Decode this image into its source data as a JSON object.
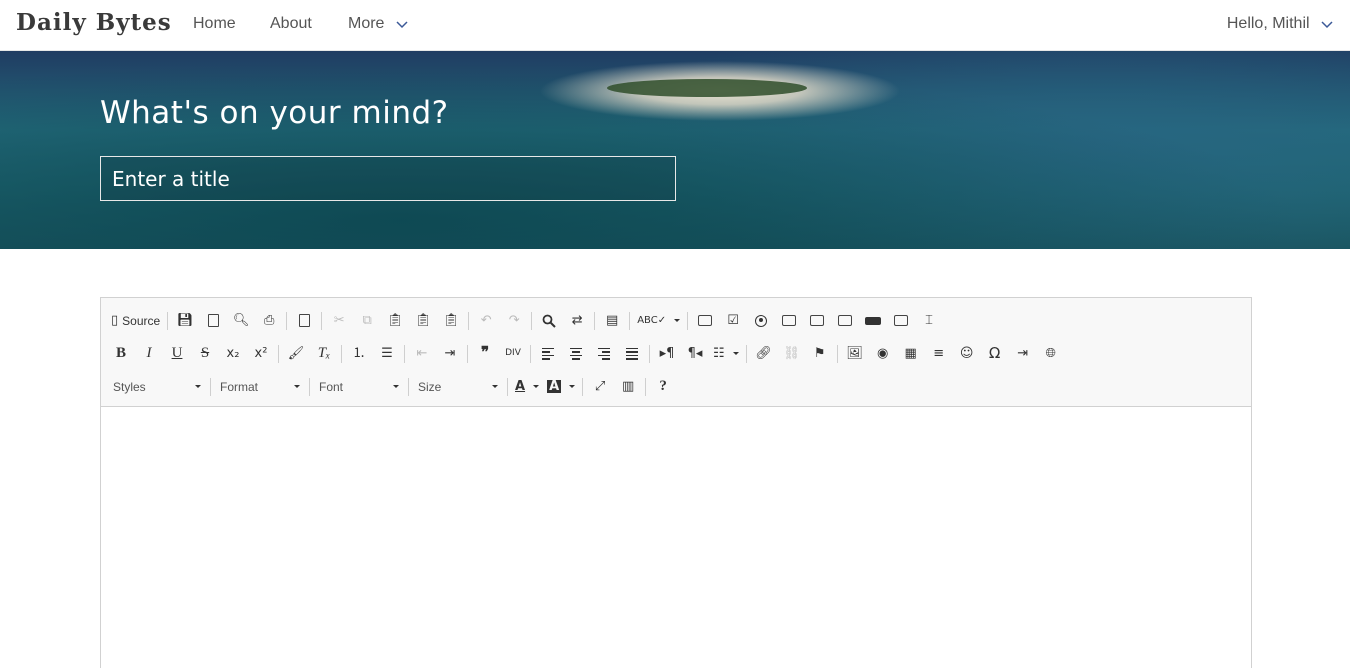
{
  "navbar": {
    "brand": "Daily Bytes",
    "links": [
      "Home",
      "About",
      "More"
    ],
    "user_label": "Hello, Mithil"
  },
  "hero": {
    "heading": "What's on your mind?",
    "title_placeholder": "Enter a title"
  },
  "editor": {
    "source_label": "Source",
    "combos": {
      "styles": "Styles",
      "format": "Format",
      "font": "Font",
      "size": "Size"
    },
    "help_label": "?",
    "content": ""
  },
  "colors": {
    "nav_bg": "#ffffff",
    "toolbar_bg": "#f8f8f8",
    "hero_text": "#ffffff"
  }
}
